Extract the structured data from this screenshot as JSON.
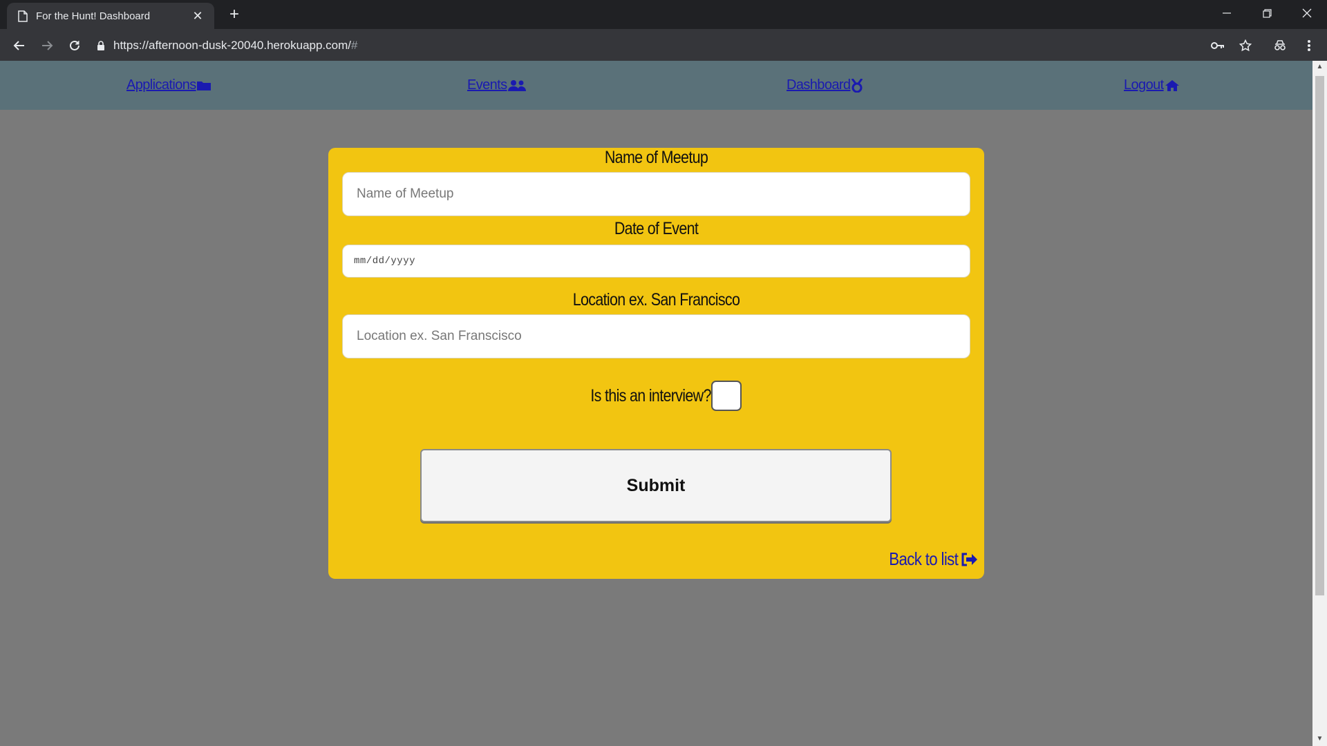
{
  "browser": {
    "tab_title": "For the Hunt! Dashboard",
    "tab_close": "✕",
    "new_tab": "+",
    "url_main": "https://afternoon-dusk-20040.herokuapp.com/",
    "url_hash": "#"
  },
  "navbar": {
    "items": [
      {
        "label": "Applications",
        "icon": "folder-icon"
      },
      {
        "label": "Events",
        "icon": "users-icon"
      },
      {
        "label": "Dashboard",
        "icon": "medal-icon"
      },
      {
        "label": "Logout",
        "icon": "home-icon"
      }
    ]
  },
  "form": {
    "name_label": "Name of Meetup",
    "name_placeholder": "Name of Meetup",
    "date_label": "Date of Event",
    "date_placeholder": "mm/dd/yyyy",
    "location_label": "Location ex. San Francisco",
    "location_placeholder": "Location ex. San Franscisco",
    "interview_label": "Is this an interview?",
    "interview_checked": false,
    "submit_label": "Submit",
    "back_label": "Back to list"
  },
  "colors": {
    "card": "#f2c511",
    "navbar": "#5a7179",
    "page_bg": "#7a7a7a",
    "link": "#1a1ab0"
  }
}
